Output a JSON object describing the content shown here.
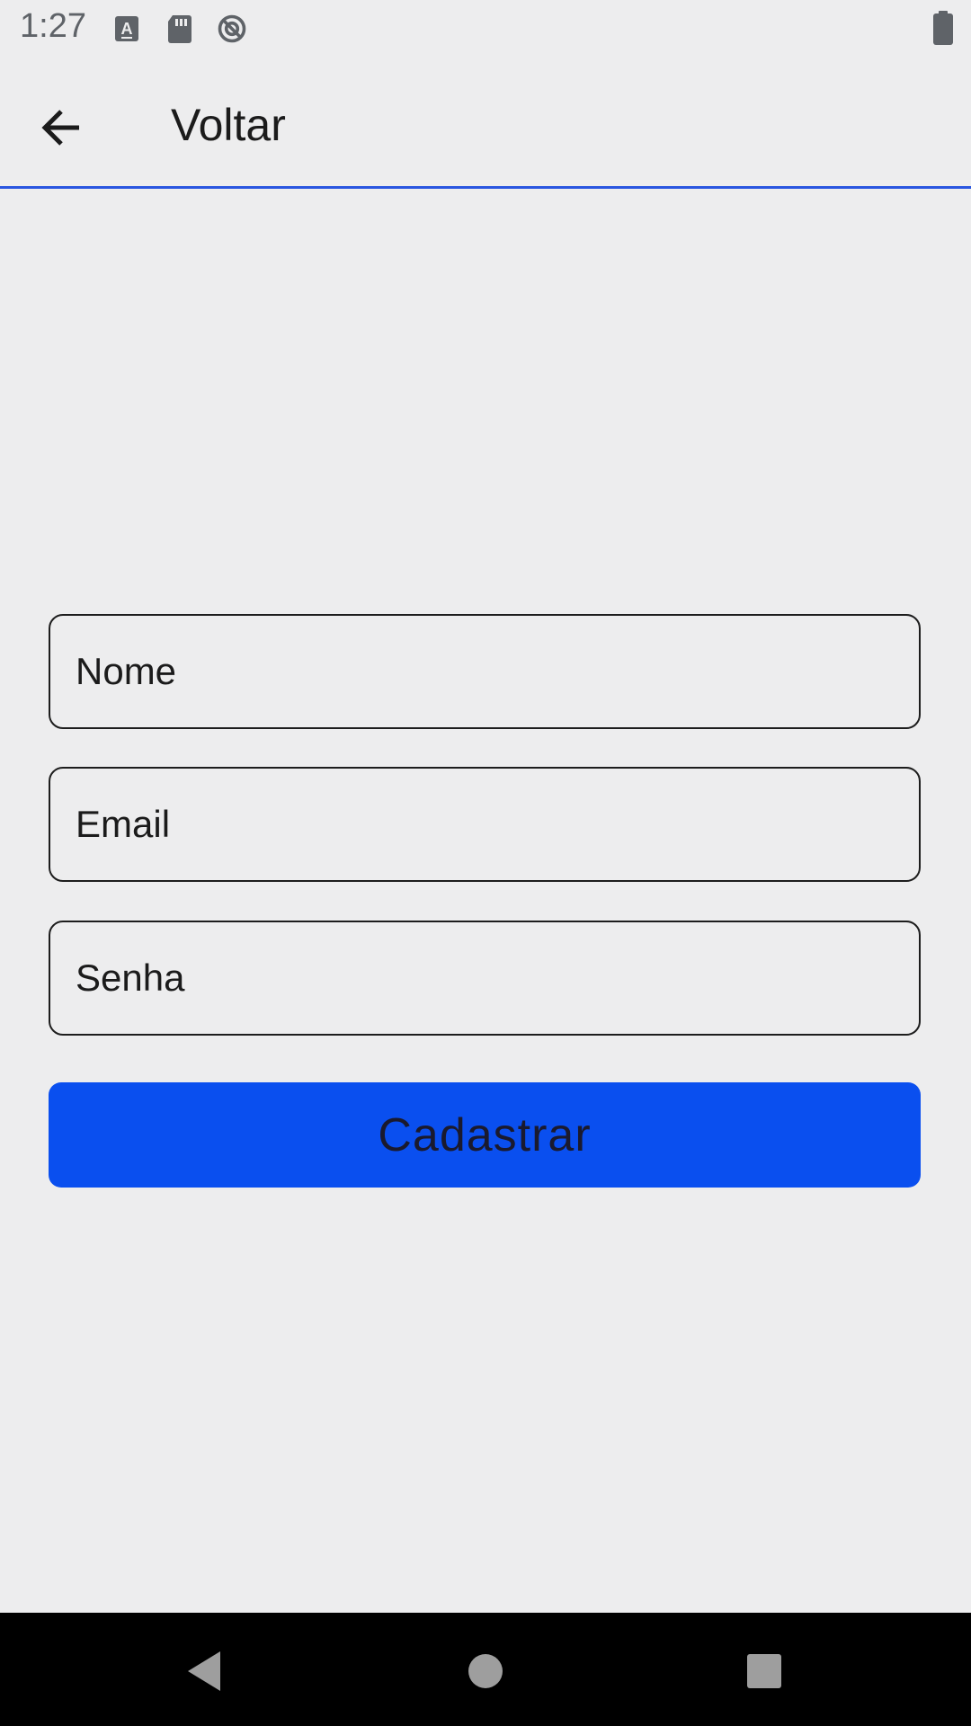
{
  "status_bar": {
    "time": "1:27",
    "icons": [
      "keyboard-a-icon",
      "sd-card-icon",
      "no-sync-icon"
    ],
    "battery_icon": "battery-icon"
  },
  "app_bar": {
    "back_icon": "arrow-back-icon",
    "title": "Voltar",
    "divider_color": "#2A56E0"
  },
  "form": {
    "name_placeholder": "Nome",
    "email_placeholder": "Email",
    "password_placeholder": "Senha",
    "submit_label": "Cadastrar",
    "submit_color": "#0A4FEF"
  },
  "nav_bar": {
    "back_icon": "triangle-back-icon",
    "home_icon": "circle-home-icon",
    "recents_icon": "square-recents-icon"
  }
}
